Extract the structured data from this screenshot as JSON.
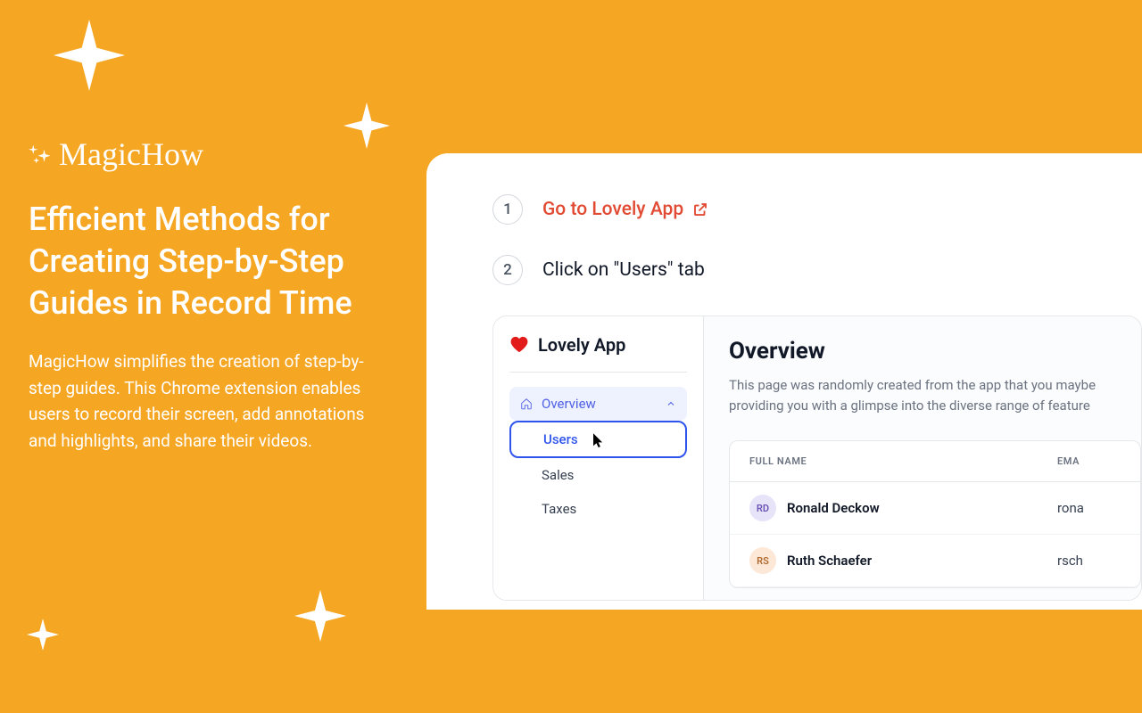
{
  "brand": {
    "name": "MagicHow"
  },
  "headline": "Efficient Methods for Creating Step-by-Step Guides in Record Time",
  "description": "MagicHow simplifies the creation of step-by-step guides. This Chrome extension enables users to record their screen, add annotations and highlights, and share their videos.",
  "steps": [
    {
      "num": "1",
      "label": "Go to Lovely App",
      "link": true
    },
    {
      "num": "2",
      "label": "Click on \"Users\" tab",
      "link": false
    }
  ],
  "preview": {
    "app_name": "Lovely App",
    "nav": {
      "parent": "Overview",
      "children": [
        "Users",
        "Sales",
        "Taxes"
      ],
      "active": "Users"
    },
    "main": {
      "title": "Overview",
      "desc_l1": "This page was randomly created from the app that you maybe",
      "desc_l2": "providing you with a glimpse into the diverse range of feature",
      "columns": {
        "name": "FULL NAME",
        "email": "EMA"
      },
      "rows": [
        {
          "initials": "RD",
          "name": "Ronald Deckow",
          "email": "rona"
        },
        {
          "initials": "RS",
          "name": "Ruth Schaefer",
          "email": "rsch"
        }
      ]
    }
  }
}
